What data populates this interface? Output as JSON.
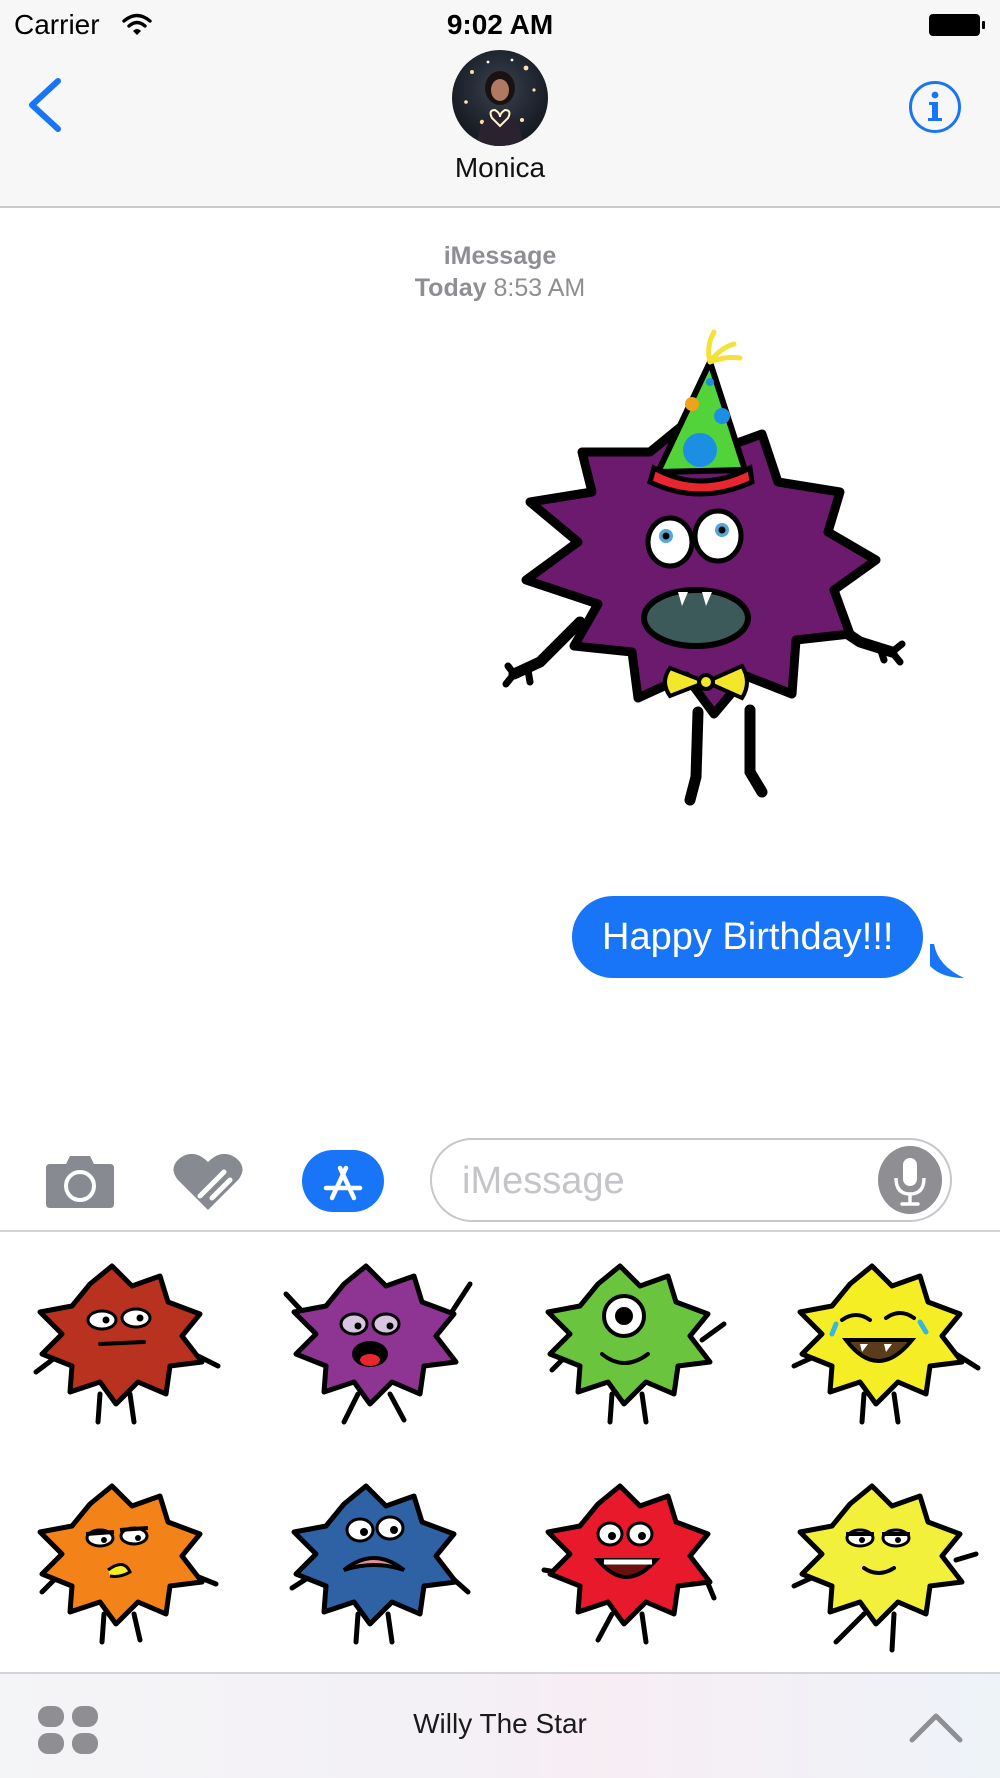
{
  "status_bar": {
    "carrier": "Carrier",
    "time": "9:02 AM"
  },
  "nav": {
    "contact_name": "Monica"
  },
  "conversation": {
    "service": "iMessage",
    "day": "Today",
    "time": "8:53 AM",
    "sticker_message": "party-hat-purple-star",
    "outgoing_text": "Happy Birthday!!!"
  },
  "input": {
    "placeholder": "iMessage"
  },
  "drawer": {
    "stickers": [
      {
        "color": "#b8321f",
        "mood": "deadpan"
      },
      {
        "color": "#8e3492",
        "mood": "excited"
      },
      {
        "color": "#6ac43d",
        "mood": "cyclops"
      },
      {
        "color": "#f5ee24",
        "mood": "laughing-tears"
      },
      {
        "color": "#f38219",
        "mood": "skeptical"
      },
      {
        "color": "#2f62a5",
        "mood": "worried"
      },
      {
        "color": "#e8192b",
        "mood": "grinning"
      },
      {
        "color": "#f3f03c",
        "mood": "content"
      }
    ]
  },
  "app_strip": {
    "app_name": "Willy The Star"
  },
  "colors": {
    "accent": "#1875f7",
    "bubble": "#1875f7",
    "sticker_purple": "#6b1a6e"
  }
}
